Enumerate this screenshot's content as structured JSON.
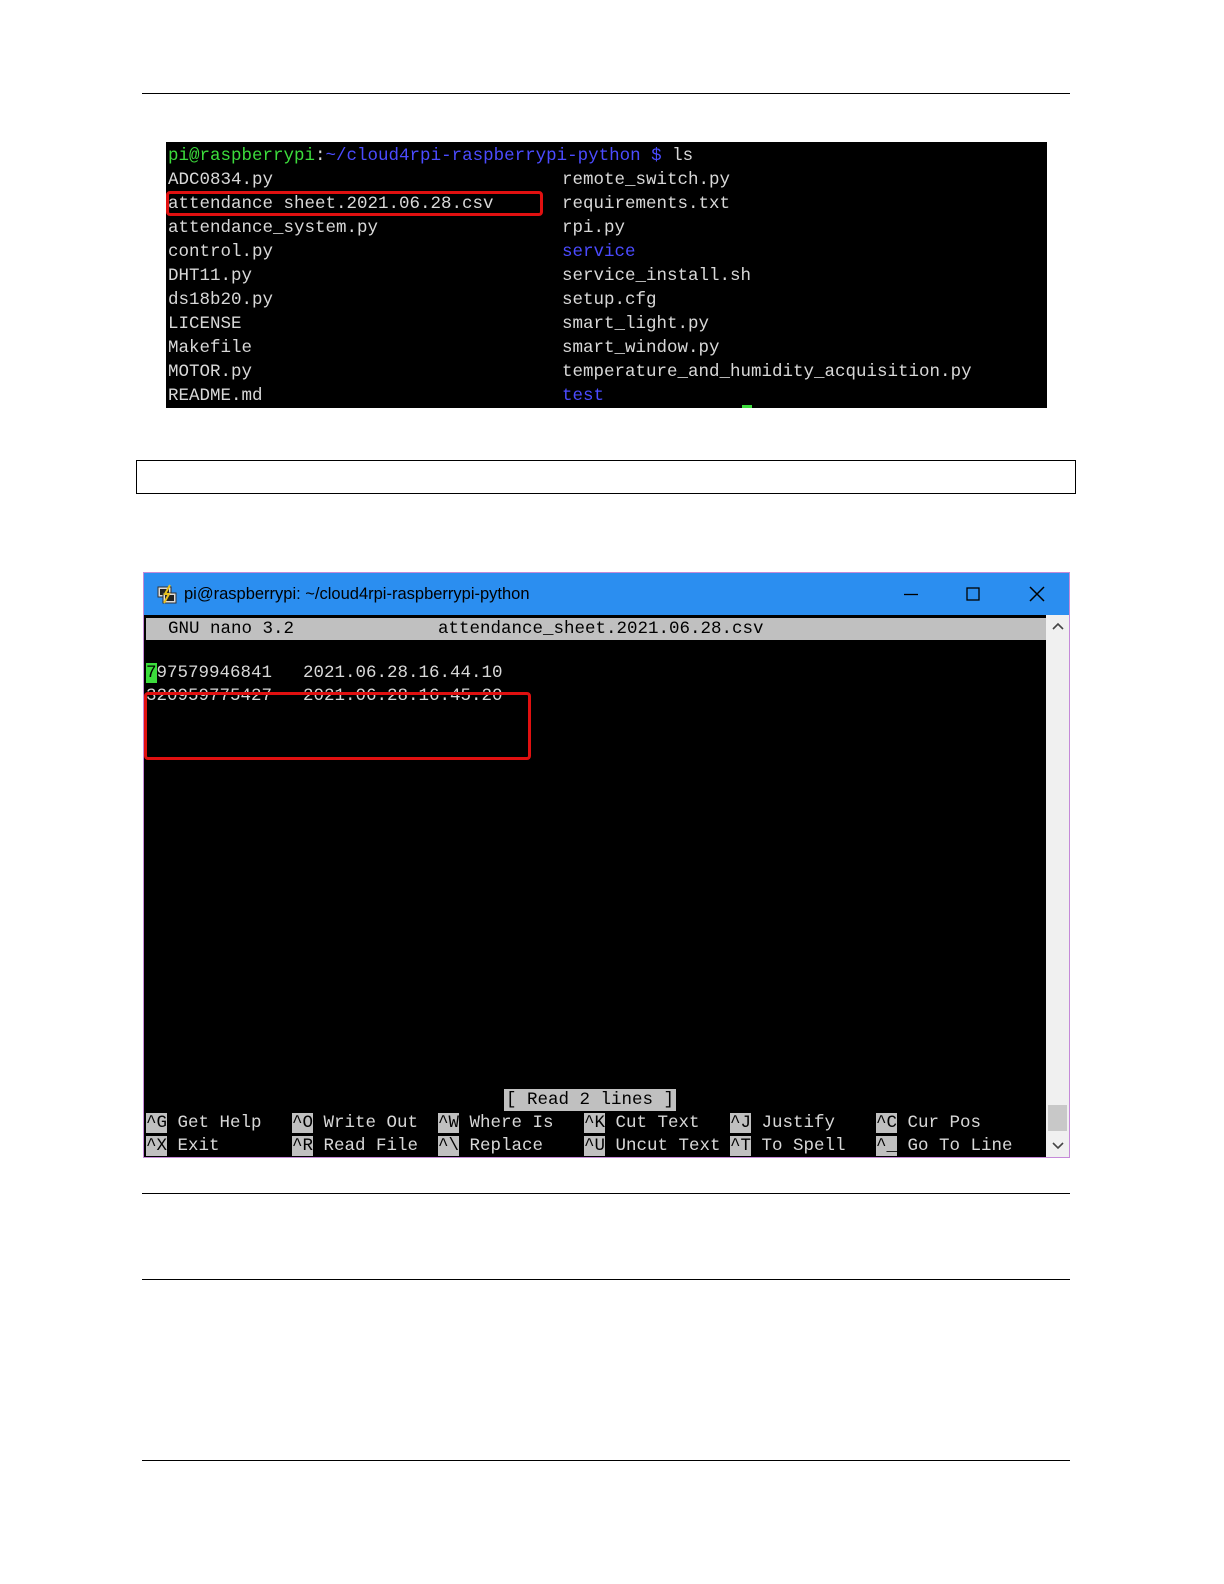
{
  "terminal_ls": {
    "prompt_user": "pi@raspberrypi",
    "prompt_sep": ":",
    "prompt_path": "~/cloud4rpi-raspberrypi-python $",
    "prompt_cmd": " ls",
    "left_files": [
      "ADC0834.py",
      "attendance sheet.2021.06.28.csv",
      "attendance_system.py",
      "control.py",
      "DHT11.py",
      "ds18b20.py",
      "LICENSE",
      "Makefile",
      "MOTOR.py",
      "README.md"
    ],
    "right_files": [
      "remote_switch.py",
      "requirements.txt",
      "rpi.py",
      "service",
      "service_install.sh",
      "setup.cfg",
      "smart_light.py",
      "smart_window.py",
      "temperature_and_humidity_acquisition.py",
      "test"
    ],
    "directory_color": "#4b4bff",
    "prompt_color": "#3cdc3c"
  },
  "putty_window": {
    "title": "pi@raspberrypi: ~/cloud4rpi-raspberrypi-python",
    "nano_version": "GNU nano 3.2",
    "file_name": "attendance_sheet.2021.06.28.csv",
    "cursor_char": "7",
    "rows": [
      {
        "rest": "97579946841",
        "timestamp": "2021.06.28.16.44.10"
      },
      {
        "id": "320959775427",
        "timestamp": "2021.06.28.16.45.20"
      }
    ],
    "status": "[ Read 2 lines ]",
    "shortcuts_row1": [
      {
        "key": "^G",
        "label": "Get Help"
      },
      {
        "key": "^O",
        "label": "Write Out"
      },
      {
        "key": "^W",
        "label": "Where Is"
      },
      {
        "key": "^K",
        "label": "Cut Text"
      },
      {
        "key": "^J",
        "label": "Justify"
      },
      {
        "key": "^C",
        "label": "Cur Pos"
      }
    ],
    "shortcuts_row2": [
      {
        "key": "^X",
        "label": "Exit"
      },
      {
        "key": "^R",
        "label": "Read File"
      },
      {
        "key": "^\\",
        "label": "Replace"
      },
      {
        "key": "^U",
        "label": "Uncut Text"
      },
      {
        "key": "^T",
        "label": "To Spell"
      },
      {
        "key": "^_",
        "label": "Go To Line"
      }
    ],
    "titlebar_color": "#2b8ef0",
    "highlight_color": "#e01010"
  }
}
